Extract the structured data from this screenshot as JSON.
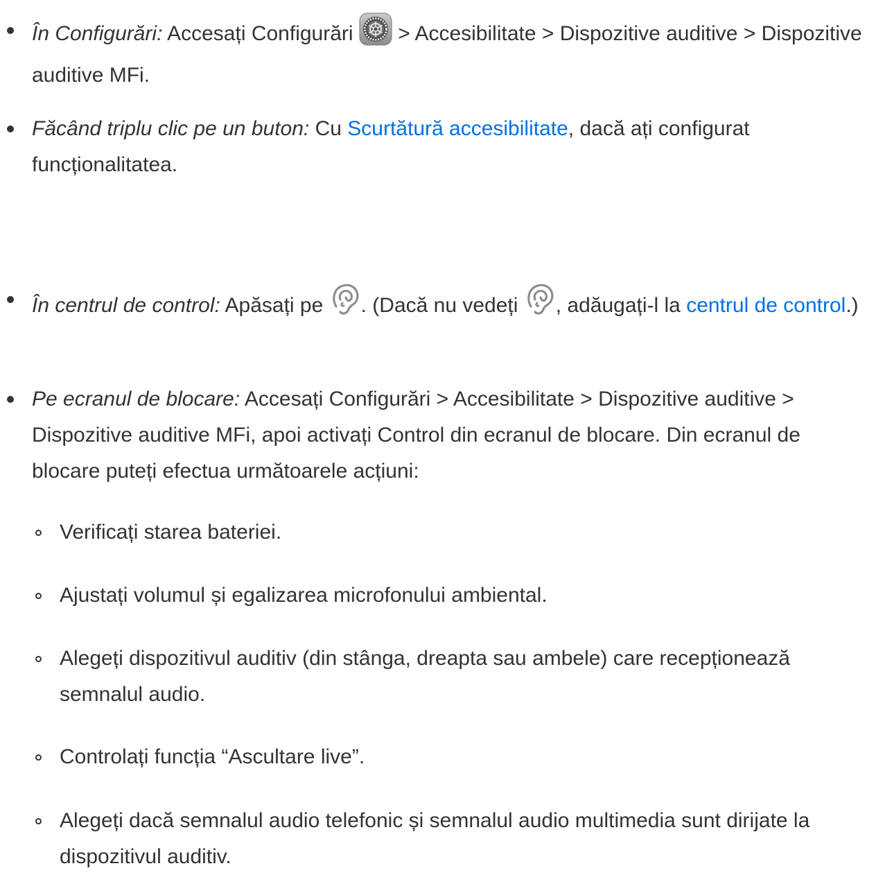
{
  "items": [
    {
      "prefix": "În Configurări:",
      "text_a": " Accesați Configurări ",
      "icon": "settings-gear-icon",
      "text_b": " > Accesibilitate > Dispozitive auditive > Dispozitive auditive MFi."
    },
    {
      "prefix": "Făcând triplu clic pe un buton:",
      "text_a": " Cu ",
      "link": "Scurtătură accesibilitate",
      "text_b": ", dacă ați configurat funcționalitatea."
    },
    {
      "prefix": "În centrul de control:",
      "text_a": " Apăsați pe ",
      "icon": "hearing-ear-icon",
      "text_b": ". (Dacă nu vedeți ",
      "text_c": ", adăugați-l la ",
      "link": "centrul de control",
      "text_d": ".)"
    },
    {
      "prefix": "Pe ecranul de blocare:",
      "text_a": " Accesați Configurări > Accesibilitate > Dispozitive auditive > Dispozitive auditive MFi, apoi activați Control din ecranul de blocare. Din ecranul de blocare puteți efectua următoarele acțiuni:"
    }
  ],
  "subitems": [
    "Verificați starea bateriei.",
    "Ajustați volumul și egalizarea microfonului ambiental.",
    "Alegeți dispozitivul auditiv (din stânga, dreapta sau ambele) care recepționează semnalul audio.",
    "Controlați funcția “Ascultare live”.",
    "Alegeți dacă semnalul audio telefonic și semnalul audio multimedia sunt dirijate la dispozitivul auditiv."
  ],
  "colors": {
    "text": "#333333",
    "link": "#0071e3"
  }
}
